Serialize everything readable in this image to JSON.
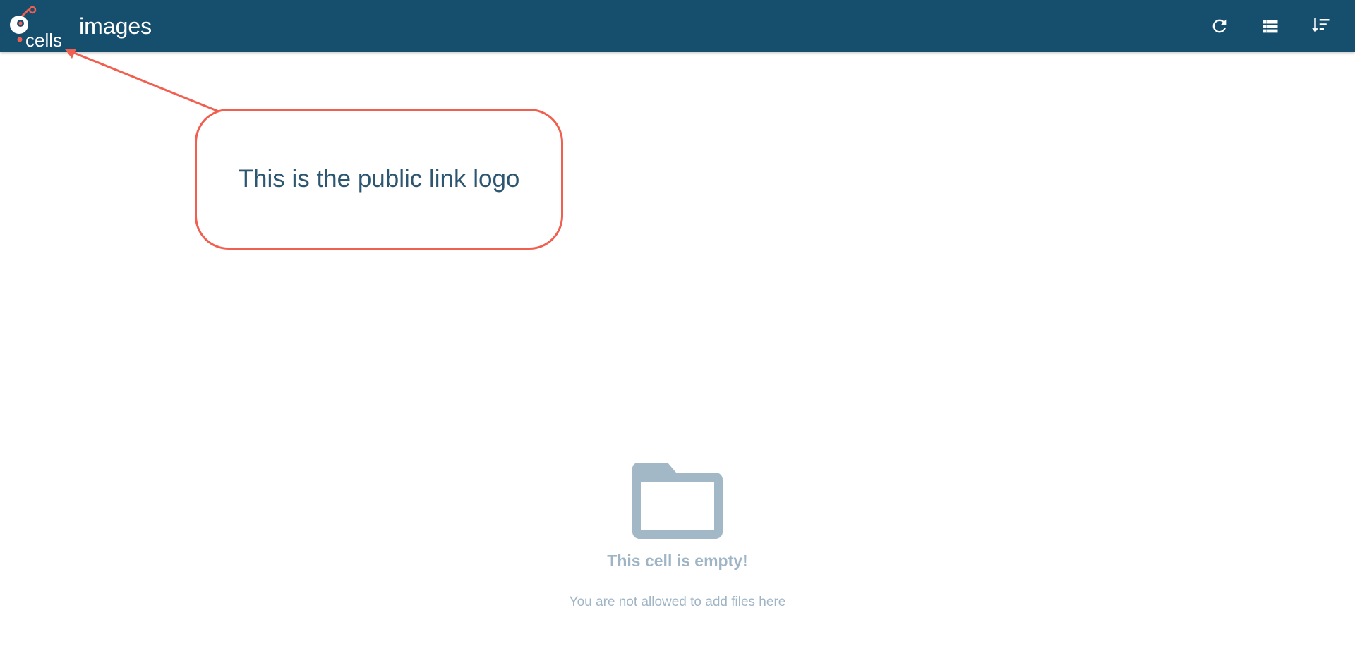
{
  "header": {
    "brand_text": "cells",
    "folder_name": "images",
    "icons": {
      "refresh": "refresh-icon",
      "list": "view-list-icon",
      "sort": "sort-icon"
    }
  },
  "annotation": {
    "text": "This is the public link logo",
    "color": "#f05f4f"
  },
  "empty_state": {
    "icon": "folder-icon",
    "title": "This cell is empty!",
    "subtitle": "You are not allowed to add files here"
  },
  "colors": {
    "topbar": "#164e6e",
    "accent": "#f05f4f",
    "muted": "#9fb5c5"
  }
}
